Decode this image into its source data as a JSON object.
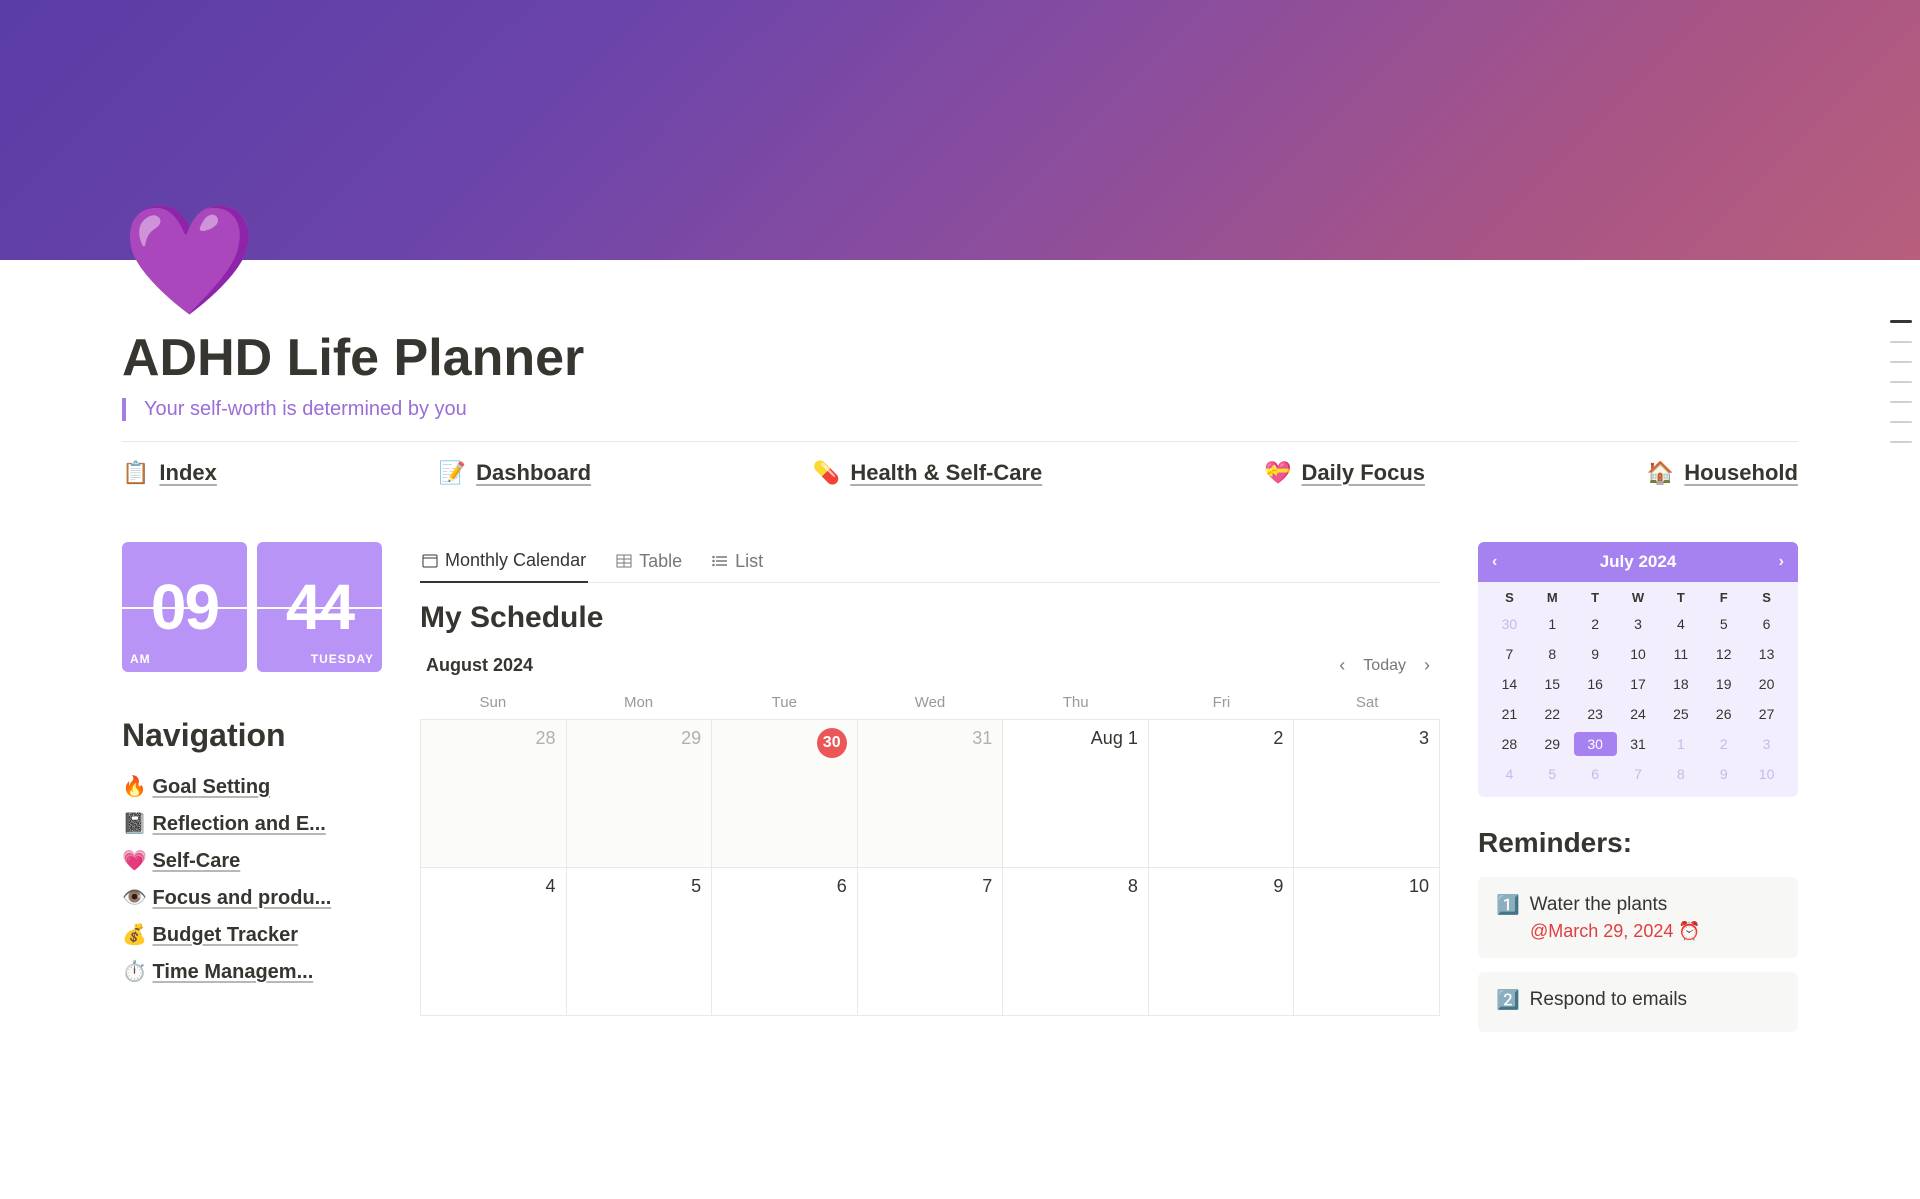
{
  "page": {
    "icon": "💜",
    "title": "ADHD Life Planner",
    "subtitle": "Your self-worth is determined by you"
  },
  "topNav": [
    {
      "icon": "📋",
      "label": "Index"
    },
    {
      "icon": "📝",
      "label": "Dashboard"
    },
    {
      "icon": "💊",
      "label": "Health & Self-Care"
    },
    {
      "icon": "💝",
      "label": "Daily Focus"
    },
    {
      "icon": "🏠",
      "label": "Household"
    }
  ],
  "clock": {
    "hour": "09",
    "minute": "44",
    "ampm": "AM",
    "day": "TUESDAY"
  },
  "navHeading": "Navigation",
  "navItems": [
    {
      "icon": "🔥",
      "label": "Goal Setting"
    },
    {
      "icon": "📓",
      "label": "Reflection and E..."
    },
    {
      "icon": "💗",
      "label": "Self-Care"
    },
    {
      "icon": "👁️",
      "label": "Focus and produ..."
    },
    {
      "icon": "💰",
      "label": "Budget Tracker"
    },
    {
      "icon": "⏱️",
      "label": "Time Managem..."
    }
  ],
  "tabs": {
    "monthly": "Monthly Calendar",
    "table": "Table",
    "list": "List"
  },
  "schedule": {
    "title": "My Schedule",
    "monthLabel": "August 2024",
    "todayLabel": "Today",
    "dow": [
      "Sun",
      "Mon",
      "Tue",
      "Wed",
      "Thu",
      "Fri",
      "Sat"
    ],
    "row1": [
      {
        "text": "28",
        "out": true
      },
      {
        "text": "29",
        "out": true
      },
      {
        "text": "30",
        "out": true,
        "today": true
      },
      {
        "text": "31",
        "out": true
      },
      {
        "text": "Aug 1"
      },
      {
        "text": "2"
      },
      {
        "text": "3"
      }
    ],
    "row2": [
      {
        "text": "4"
      },
      {
        "text": "5"
      },
      {
        "text": "6"
      },
      {
        "text": "7"
      },
      {
        "text": "8"
      },
      {
        "text": "9"
      },
      {
        "text": "10"
      }
    ]
  },
  "miniCal": {
    "title": "July 2024",
    "dow": [
      "S",
      "M",
      "T",
      "W",
      "T",
      "F",
      "S"
    ],
    "rows": [
      [
        {
          "t": "30",
          "o": true
        },
        {
          "t": "1"
        },
        {
          "t": "2"
        },
        {
          "t": "3"
        },
        {
          "t": "4"
        },
        {
          "t": "5"
        },
        {
          "t": "6"
        }
      ],
      [
        {
          "t": "7"
        },
        {
          "t": "8"
        },
        {
          "t": "9"
        },
        {
          "t": "10"
        },
        {
          "t": "11"
        },
        {
          "t": "12"
        },
        {
          "t": "13"
        }
      ],
      [
        {
          "t": "14"
        },
        {
          "t": "15"
        },
        {
          "t": "16"
        },
        {
          "t": "17"
        },
        {
          "t": "18"
        },
        {
          "t": "19"
        },
        {
          "t": "20"
        }
      ],
      [
        {
          "t": "21"
        },
        {
          "t": "22"
        },
        {
          "t": "23"
        },
        {
          "t": "24"
        },
        {
          "t": "25"
        },
        {
          "t": "26"
        },
        {
          "t": "27"
        }
      ],
      [
        {
          "t": "28"
        },
        {
          "t": "29"
        },
        {
          "t": "30",
          "sel": true
        },
        {
          "t": "31"
        },
        {
          "t": "1",
          "o": true
        },
        {
          "t": "2",
          "o": true
        },
        {
          "t": "3",
          "o": true
        }
      ],
      [
        {
          "t": "4",
          "o": true
        },
        {
          "t": "5",
          "o": true
        },
        {
          "t": "6",
          "o": true
        },
        {
          "t": "7",
          "o": true
        },
        {
          "t": "8",
          "o": true
        },
        {
          "t": "9",
          "o": true
        },
        {
          "t": "10",
          "o": true
        }
      ]
    ]
  },
  "reminders": {
    "title": "Reminders:",
    "items": [
      {
        "icon": "1️⃣",
        "text": "Water the plants",
        "date": "@March 29, 2024 ⏰"
      },
      {
        "icon": "2️⃣",
        "text": "Respond to emails",
        "date": ""
      }
    ]
  }
}
